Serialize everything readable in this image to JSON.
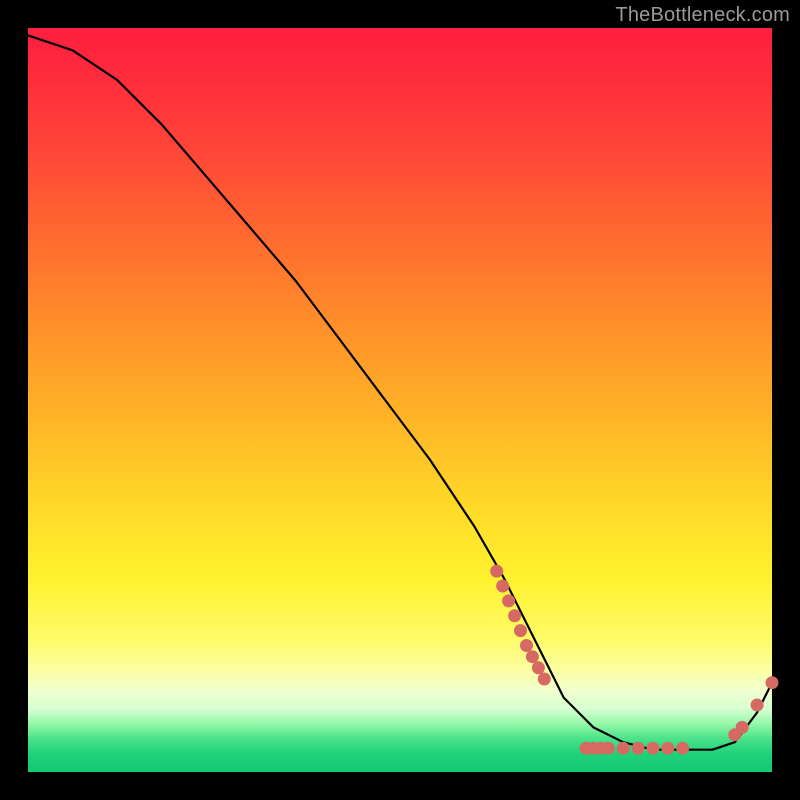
{
  "watermark": "TheBottleneck.com",
  "chart_data": {
    "type": "line",
    "title": "",
    "xlabel": "",
    "ylabel": "",
    "xlim": [
      0,
      100
    ],
    "ylim": [
      0,
      100
    ],
    "grid": false,
    "series": [
      {
        "name": "curve",
        "color": "#000000",
        "x": [
          0,
          6,
          12,
          18,
          24,
          30,
          36,
          42,
          48,
          54,
          60,
          64,
          68,
          70,
          72,
          76,
          80,
          84,
          88,
          92,
          95,
          98,
          100
        ],
        "y": [
          99,
          97,
          93,
          87,
          80,
          73,
          66,
          58,
          50,
          42,
          33,
          26,
          18,
          14,
          10,
          6,
          4,
          3,
          3,
          3,
          4,
          8,
          12
        ]
      }
    ],
    "markers": [
      {
        "shape": "circle",
        "color": "#d66a63",
        "x": 63,
        "y": 27
      },
      {
        "shape": "circle",
        "color": "#d66a63",
        "x": 63.8,
        "y": 25
      },
      {
        "shape": "circle",
        "color": "#d66a63",
        "x": 64.6,
        "y": 23
      },
      {
        "shape": "circle",
        "color": "#d66a63",
        "x": 65.4,
        "y": 21
      },
      {
        "shape": "circle",
        "color": "#d66a63",
        "x": 66.2,
        "y": 19
      },
      {
        "shape": "circle",
        "color": "#d66a63",
        "x": 67.0,
        "y": 17
      },
      {
        "shape": "circle",
        "color": "#d66a63",
        "x": 67.8,
        "y": 15.5
      },
      {
        "shape": "circle",
        "color": "#d66a63",
        "x": 68.6,
        "y": 14
      },
      {
        "shape": "circle",
        "color": "#d66a63",
        "x": 69.4,
        "y": 12.5
      },
      {
        "shape": "circle",
        "color": "#d66a63",
        "x": 75,
        "y": 3.2
      },
      {
        "shape": "circle",
        "color": "#d66a63",
        "x": 76,
        "y": 3.2
      },
      {
        "shape": "circle",
        "color": "#d66a63",
        "x": 77,
        "y": 3.2
      },
      {
        "shape": "circle",
        "color": "#d66a63",
        "x": 78,
        "y": 3.2
      },
      {
        "shape": "circle",
        "color": "#d66a63",
        "x": 80,
        "y": 3.2
      },
      {
        "shape": "circle",
        "color": "#d66a63",
        "x": 82,
        "y": 3.2
      },
      {
        "shape": "circle",
        "color": "#d66a63",
        "x": 84,
        "y": 3.2
      },
      {
        "shape": "circle",
        "color": "#d66a63",
        "x": 86,
        "y": 3.2
      },
      {
        "shape": "circle",
        "color": "#d66a63",
        "x": 88,
        "y": 3.2
      },
      {
        "shape": "circle",
        "color": "#d66a63",
        "x": 95,
        "y": 5
      },
      {
        "shape": "circle",
        "color": "#d66a63",
        "x": 96,
        "y": 6
      },
      {
        "shape": "circle",
        "color": "#d66a63",
        "x": 98,
        "y": 9
      },
      {
        "shape": "circle",
        "color": "#d66a63",
        "x": 100,
        "y": 12
      }
    ],
    "background_gradient": {
      "top": "#ff1f3f",
      "mid": "#ffd828",
      "bottom": "#14c873"
    }
  }
}
